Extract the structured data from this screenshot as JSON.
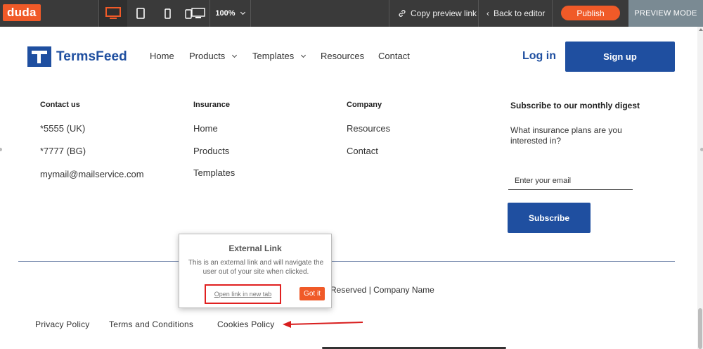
{
  "topbar": {
    "logo": "duda",
    "zoom": "100%",
    "copy_preview": "Copy preview link",
    "back_to_editor": "Back to editor",
    "publish": "Publish",
    "preview_mode": "PREVIEW MODE",
    "accent_color": "#f05a28"
  },
  "header": {
    "brand": "TermsFeed",
    "nav": [
      {
        "label": "Home"
      },
      {
        "label": "Products"
      },
      {
        "label": "Templates"
      },
      {
        "label": "Resources"
      },
      {
        "label": "Contact"
      }
    ],
    "login": "Log in",
    "signup": "Sign up",
    "brand_color": "#1f4fa0"
  },
  "footer": {
    "contact": {
      "heading": "Contact us",
      "items": [
        "*5555 (UK)",
        "*7777 (BG)",
        "mymail@mailservice.com"
      ]
    },
    "insurance": {
      "heading": "Insurance",
      "items": [
        "Home",
        "Products",
        "Templates"
      ]
    },
    "company": {
      "heading": "Company",
      "items": [
        "Resources",
        "Contact"
      ]
    },
    "subscribe": {
      "heading": "Subscribe to our monthly digest",
      "text": "What insurance plans are you interested in?",
      "placeholder": "Enter your email",
      "button": "Subscribe"
    },
    "copyright": "Reserved | Company Name",
    "legal": [
      "Privacy Policy",
      "Terms and Conditions",
      "Cookies Policy"
    ]
  },
  "popup": {
    "title": "External Link",
    "body": "This is an external link and will navigate the user out of your site when clicked.",
    "open_link": "Open link in new tab",
    "got_it": "Got it"
  }
}
